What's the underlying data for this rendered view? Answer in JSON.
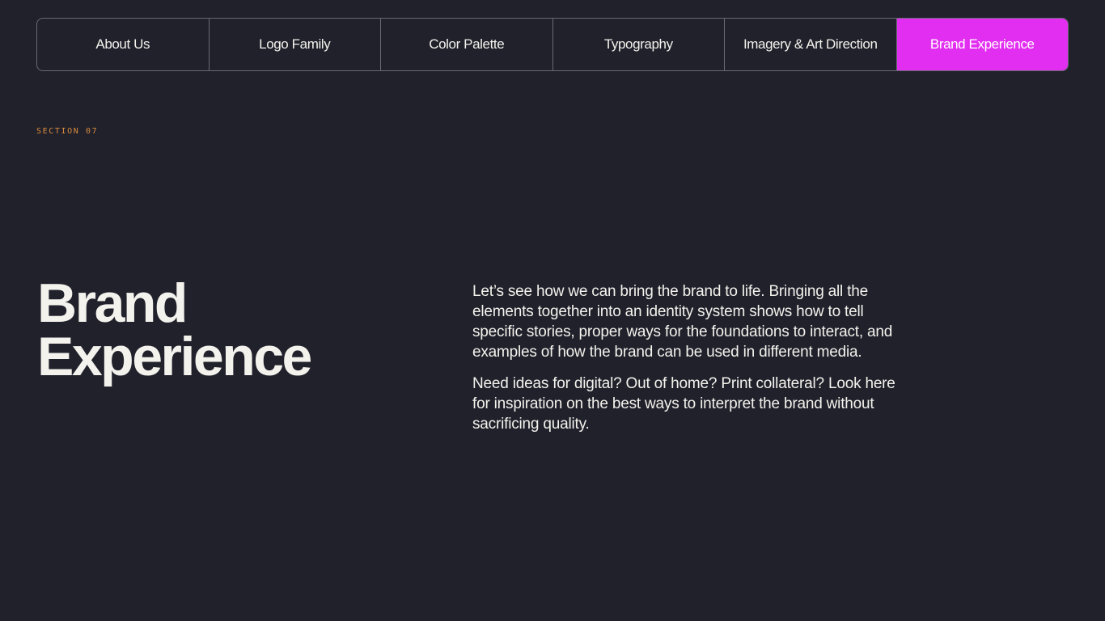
{
  "nav": {
    "tabs": [
      {
        "label": "About Us",
        "active": false
      },
      {
        "label": "Logo Family",
        "active": false
      },
      {
        "label": "Color Palette",
        "active": false
      },
      {
        "label": "Typography",
        "active": false
      },
      {
        "label": "Imagery & Art Direction",
        "active": false
      },
      {
        "label": "Brand Experience",
        "active": true
      }
    ]
  },
  "section": {
    "label": "SECTION 07"
  },
  "hero": {
    "title_line1": "Brand",
    "title_line2": "Experience",
    "paragraphs": [
      "Let’s see how we can bring the brand to life. Bringing all the elements together into an identity system shows how to tell specific stories, proper ways for the foundations to interact, and examples of how the brand can be used in different media.",
      "Need ideas for digital? Out of home? Print collateral? Look here for inspiration on the best ways to interpret the brand without sacrificing quality."
    ]
  },
  "colors": {
    "background": "#21212c",
    "accent": "#e22ef0",
    "section_label": "#d88b3c",
    "text": "#f3f2ec"
  }
}
